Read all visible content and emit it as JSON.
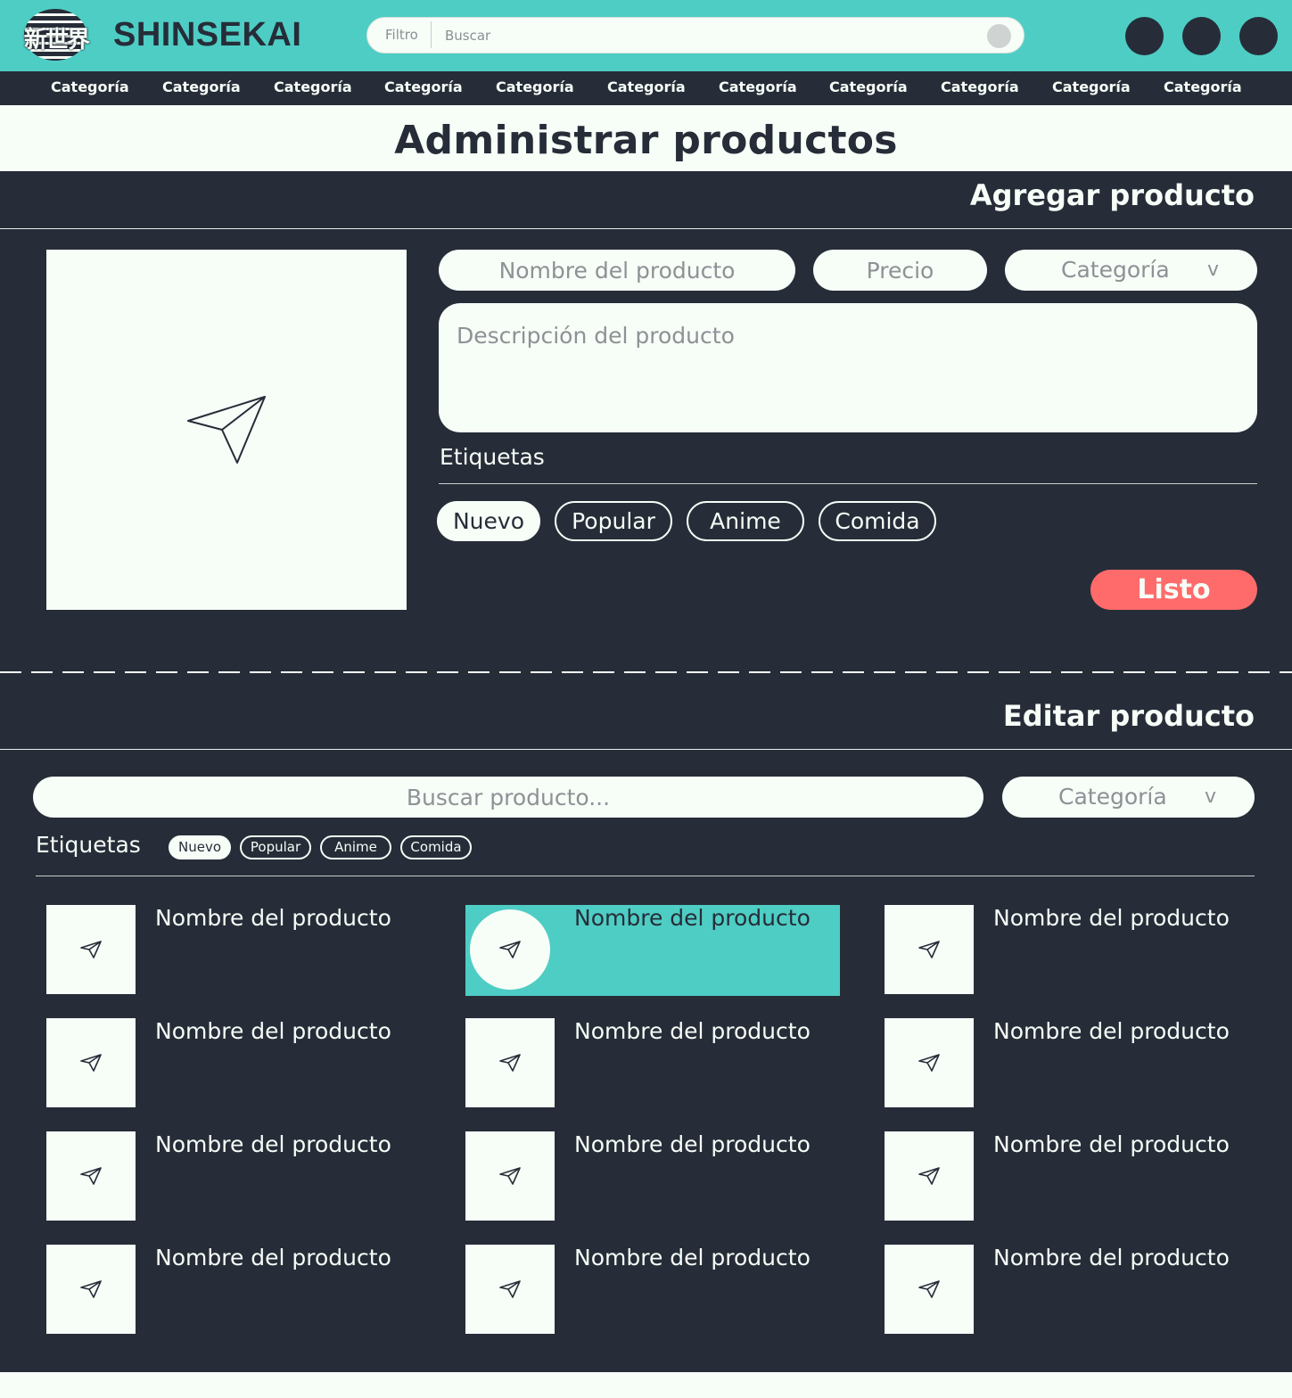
{
  "brand": {
    "logo_kanji": "新世界",
    "name": "SHINSEKAI"
  },
  "colors": {
    "accent": "#4ecdc4",
    "dark": "#262d38",
    "light": "#f7fdf7",
    "cta": "#ff6b6b"
  },
  "header": {
    "search": {
      "filter_label": "Filtro",
      "placeholder": "Buscar"
    },
    "icon_buttons": [
      "user-icon",
      "cart-icon",
      "menu-icon"
    ]
  },
  "categories": [
    "Categoría",
    "Categoría",
    "Categoría",
    "Categoría",
    "Categoría",
    "Categoría",
    "Categoría",
    "Categoría",
    "Categoría",
    "Categoría",
    "Categoría"
  ],
  "page": {
    "title": "Administrar productos"
  },
  "add_product": {
    "title": "Agregar producto",
    "image_icon": "send-icon",
    "name_placeholder": "Nombre del producto",
    "price_placeholder": "Precio",
    "category_placeholder": "Categoría",
    "category_chevron": "v",
    "description_placeholder": "Descripción del producto",
    "tags_label": "Etiquetas",
    "tags": [
      {
        "label": "Nuevo",
        "active": true
      },
      {
        "label": "Popular",
        "active": false
      },
      {
        "label": "Anime",
        "active": false
      },
      {
        "label": "Comida",
        "active": false
      }
    ],
    "done_label": "Listo"
  },
  "edit_product": {
    "title": "Editar producto",
    "search_placeholder": "Buscar producto...",
    "category_placeholder": "Categoría",
    "category_chevron": "v",
    "tags_label": "Etiquetas",
    "tags": [
      {
        "label": "Nuevo",
        "active": true
      },
      {
        "label": "Popular",
        "active": false
      },
      {
        "label": "Anime",
        "active": false
      },
      {
        "label": "Comida",
        "active": false
      }
    ],
    "products": [
      {
        "name": "Nombre del producto",
        "selected": false
      },
      {
        "name": "Nombre del producto",
        "selected": true
      },
      {
        "name": "Nombre del producto",
        "selected": false
      },
      {
        "name": "Nombre del producto",
        "selected": false
      },
      {
        "name": "Nombre del producto",
        "selected": false
      },
      {
        "name": "Nombre del producto",
        "selected": false
      },
      {
        "name": "Nombre del producto",
        "selected": false
      },
      {
        "name": "Nombre del producto",
        "selected": false
      },
      {
        "name": "Nombre del producto",
        "selected": false
      },
      {
        "name": "Nombre del producto",
        "selected": false
      },
      {
        "name": "Nombre del producto",
        "selected": false
      },
      {
        "name": "Nombre del producto",
        "selected": false
      }
    ]
  }
}
